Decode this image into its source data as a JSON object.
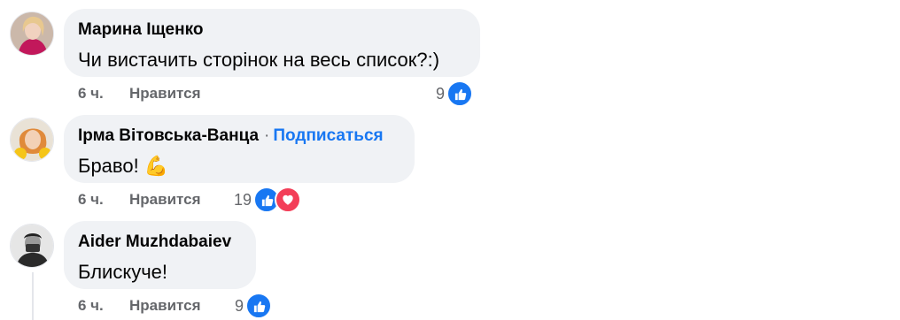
{
  "comments": [
    {
      "author": "Марина Іщенко",
      "text": "Чи вистачить сторінок на весь список?:)",
      "time": "6 ч.",
      "like_label": "Нравится",
      "reaction_count": "9",
      "reactions": [
        "like-icon"
      ],
      "colors": {
        "like": "#1877f2"
      }
    },
    {
      "author": "Ірма Вітовська-Ванца",
      "separator": "·",
      "follow_label": "Подписаться",
      "text": "Браво!",
      "emoji": "💪",
      "time": "6 ч.",
      "like_label": "Нравится",
      "reaction_count": "19",
      "reactions": [
        "like-icon",
        "love-icon"
      ],
      "colors": {
        "like": "#1877f2",
        "love": "#f33e58"
      }
    },
    {
      "author": "Aider Muzhdabaiev",
      "text": "Блискуче!",
      "time": "6 ч.",
      "like_label": "Нравится",
      "reaction_count": "9",
      "reactions": [
        "like-icon"
      ],
      "colors": {
        "like": "#1877f2"
      }
    }
  ]
}
